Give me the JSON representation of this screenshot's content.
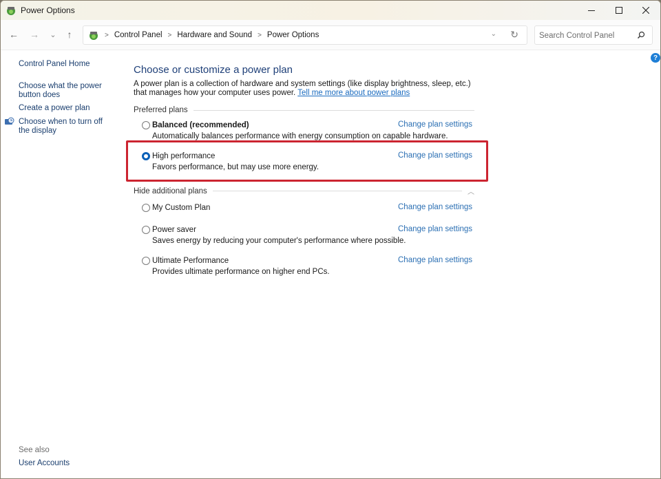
{
  "window": {
    "title": "Power Options",
    "controls": {
      "minimize": "minimize",
      "maximize": "maximize",
      "close": "close"
    }
  },
  "nav": {
    "back_icon": "←",
    "forward_icon": "→",
    "recent_icon": "⌄",
    "up_icon": "↑",
    "breadcrumb": [
      "Control Panel",
      "Hardware and Sound",
      "Power Options"
    ],
    "search_placeholder": "Search Control Panel"
  },
  "help": {
    "label": "?"
  },
  "sidebar": {
    "items": [
      {
        "label": "Control Panel Home"
      },
      {
        "label": "Choose what the power button does"
      },
      {
        "label": "Create a power plan"
      },
      {
        "label": "Choose when to turn off the display"
      }
    ],
    "see_also": "See also",
    "see_also_items": [
      {
        "label": "User Accounts"
      }
    ]
  },
  "main": {
    "title": "Choose or customize a power plan",
    "intro": "A power plan is a collection of hardware and system settings (like display brightness, sleep, etc.) that manages how your computer uses power.",
    "intro_link": "Tell me more about power plans",
    "preferred_heading": "Preferred plans",
    "additional_heading": "Hide additional plans",
    "change_label": "Change plan settings",
    "preferred_plans": [
      {
        "name": "Balanced (recommended)",
        "description": "Automatically balances performance with energy consumption on capable hardware.",
        "selected": false,
        "bold": true
      },
      {
        "name": "High performance",
        "description": "Favors performance, but may use more energy.",
        "selected": true,
        "bold": false
      }
    ],
    "additional_plans": [
      {
        "name": "My Custom Plan",
        "description": "",
        "selected": false
      },
      {
        "name": "Power saver",
        "description": "Saves energy by reducing your computer's performance where possible.",
        "selected": false
      },
      {
        "name": "Ultimate Performance",
        "description": "Provides ultimate performance on higher end PCs.",
        "selected": false
      }
    ]
  },
  "colors": {
    "accent": "#0a60b8",
    "link": "#2b6fb3",
    "title": "#1e3f78",
    "highlight": "#cc2430"
  }
}
